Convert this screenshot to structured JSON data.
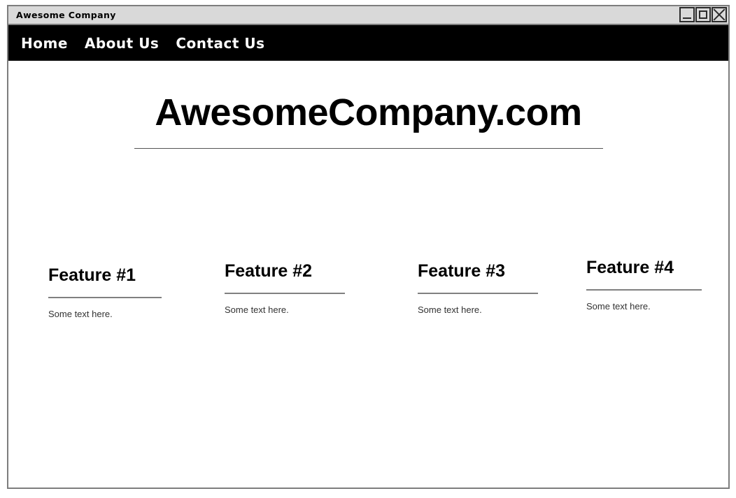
{
  "window": {
    "title": "Awesome Company",
    "controls": [
      {
        "name": "minimize",
        "glyph": "minimize-icon"
      },
      {
        "name": "maximize",
        "glyph": "maximize-icon"
      },
      {
        "name": "close",
        "glyph": "close-icon"
      }
    ]
  },
  "nav": {
    "items": [
      {
        "label": "Home"
      },
      {
        "label": "About Us"
      },
      {
        "label": "Contact Us"
      }
    ]
  },
  "hero": {
    "title": "AwesomeCompany.com"
  },
  "features": [
    {
      "title": "Feature #1",
      "text": "Some text here."
    },
    {
      "title": "Feature #2",
      "text": "Some text here."
    },
    {
      "title": "Feature #3",
      "text": "Some text here."
    },
    {
      "title": "Feature #4",
      "text": "Some text here."
    }
  ],
  "colors": {
    "navbar_bg": "#000000",
    "titlebar_bg": "#d9d9d9",
    "frame_border": "#7d7d7d",
    "rule": "#808080",
    "body_text": "#333333",
    "heading_text": "#000000"
  }
}
